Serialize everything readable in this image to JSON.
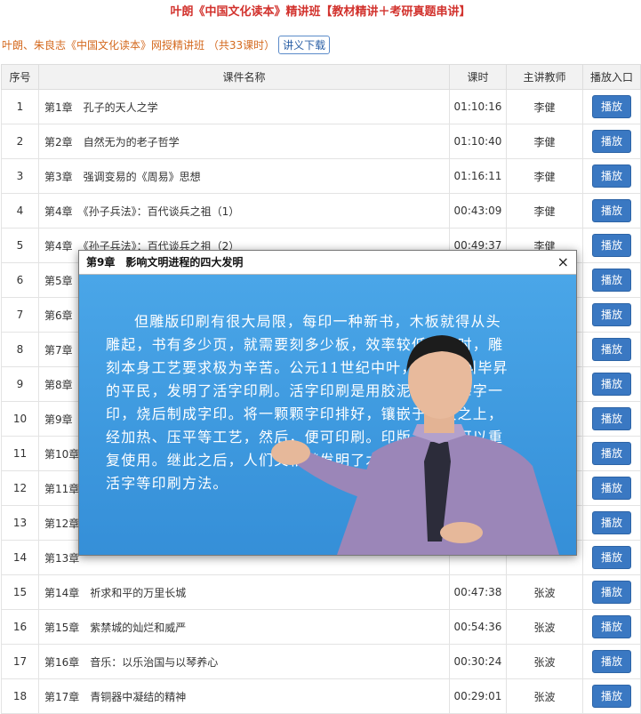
{
  "header": {
    "title": "叶朗《中国文化读本》精讲班【教材精讲＋考研真题串讲】",
    "course_line": "叶朗、朱良志《中国文化读本》网授精讲班 （共33课时）",
    "download_label": "讲义下载"
  },
  "table": {
    "columns": [
      "序号",
      "课件名称",
      "课时",
      "主讲教师",
      "播放入口"
    ],
    "play_label": "播放",
    "rows": [
      {
        "num": "1",
        "name": "第1章　孔子的天人之学",
        "time": "01:10:16",
        "teacher": "李健"
      },
      {
        "num": "2",
        "name": "第2章　自然无为的老子哲学",
        "time": "01:10:40",
        "teacher": "李健"
      },
      {
        "num": "3",
        "name": "第3章　强调变易的《周易》思想",
        "time": "01:16:11",
        "teacher": "李健"
      },
      {
        "num": "4",
        "name": "第4章　《孙子兵法》：百代谈兵之祖（1）",
        "time": "00:43:09",
        "teacher": "李健"
      },
      {
        "num": "5",
        "name": "第4章　《孙子兵法》：百代谈兵之祖（2）",
        "time": "00:49:37",
        "teacher": "李健"
      },
      {
        "num": "6",
        "name": "第5章",
        "time": "",
        "teacher": ""
      },
      {
        "num": "7",
        "name": "第6章",
        "time": "",
        "teacher": ""
      },
      {
        "num": "8",
        "name": "第7章",
        "time": "",
        "teacher": ""
      },
      {
        "num": "9",
        "name": "第8章",
        "time": "",
        "teacher": ""
      },
      {
        "num": "10",
        "name": "第9章",
        "time": "",
        "teacher": ""
      },
      {
        "num": "11",
        "name": "第10章",
        "time": "",
        "teacher": ""
      },
      {
        "num": "12",
        "name": "第11章",
        "time": "",
        "teacher": ""
      },
      {
        "num": "13",
        "name": "第12章",
        "time": "",
        "teacher": ""
      },
      {
        "num": "14",
        "name": "第13章",
        "time": "",
        "teacher": ""
      },
      {
        "num": "15",
        "name": "第14章　祈求和平的万里长城",
        "time": "00:47:38",
        "teacher": "张波"
      },
      {
        "num": "16",
        "name": "第15章　紫禁城的灿烂和威严",
        "time": "00:54:36",
        "teacher": "张波"
      },
      {
        "num": "17",
        "name": "第16章　音乐：以乐治国与以琴养心",
        "time": "00:30:24",
        "teacher": "张波"
      },
      {
        "num": "18",
        "name": "第17章　青铜器中凝结的精神",
        "time": "00:29:01",
        "teacher": "张波"
      }
    ]
  },
  "modal": {
    "title": "第9章　影响文明进程的四大发明",
    "close_glyph": "×",
    "slide_text": "但雕版印刷有很大局限，每印一种新书，木板就得从头雕起，书有多少页，就需要刻多少板，效率较低。同时，雕刻本身工艺要求极为辛苦。公元11世纪中叶，一位名叫毕昇的平民，发明了活字印刷。活字印刷是用胶泥刻字，每字一印，烧后制成字印。将一颗颗字印排好，镶嵌于铁板之上，经加热、压平等工艺，然后，便可印刷。印版上的字可以重复使用。继此之后，人们又相继发明了木活字、锡活字、铜活字等印刷方法。"
  },
  "colors": {
    "title_red": "#d2322d",
    "course_orange": "#d4691e",
    "play_blue": "#3a78c2",
    "video_blue": "#3d98de"
  }
}
